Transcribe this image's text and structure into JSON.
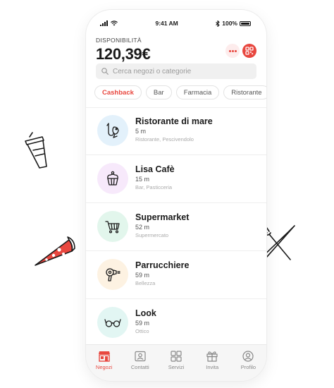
{
  "status_bar": {
    "time": "9:41 AM",
    "battery": "100%"
  },
  "header": {
    "balance_label": "DISPONIBILITÀ",
    "balance": "120,39€"
  },
  "search": {
    "placeholder": "Cerca negozi o categorie"
  },
  "chips": [
    "Cashback",
    "Bar",
    "Farmacia",
    "Ristorante"
  ],
  "stores": [
    {
      "name": "Ristorante di mare",
      "distance": "5 m",
      "category": "Ristorante, Pescivendolo",
      "icon": "seafood-icon",
      "bg": "#e3f1fb"
    },
    {
      "name": "Lisa Cafè",
      "distance": "15 m",
      "category": "Bar, Pasticceria",
      "icon": "cupcake-icon",
      "bg": "#f7e9fb"
    },
    {
      "name": "Supermarket",
      "distance": "52 m",
      "category": "Supermercato",
      "icon": "shopping-cart-icon",
      "bg": "#e2f6ec"
    },
    {
      "name": "Parrucchiere",
      "distance": "59 m",
      "category": "Bellezza",
      "icon": "hair-dryer-icon",
      "bg": "#fdf2e2"
    },
    {
      "name": "Look",
      "distance": "59 m",
      "category": "Ottico",
      "icon": "glasses-icon",
      "bg": "#e2f6f3"
    }
  ],
  "tabbar": [
    {
      "label": "Negozi",
      "icon": "store-icon",
      "active": true
    },
    {
      "label": "Contatti",
      "icon": "contacts-icon",
      "active": false
    },
    {
      "label": "Servizi",
      "icon": "services-grid-icon",
      "active": false
    },
    {
      "label": "Invita",
      "icon": "gift-icon",
      "active": false
    },
    {
      "label": "Profilo",
      "icon": "profile-icon",
      "active": false
    }
  ],
  "colors": {
    "accent": "#e8473f",
    "accent_soft": "#fdecec",
    "tabbar_bg": "#f6f6f6"
  }
}
